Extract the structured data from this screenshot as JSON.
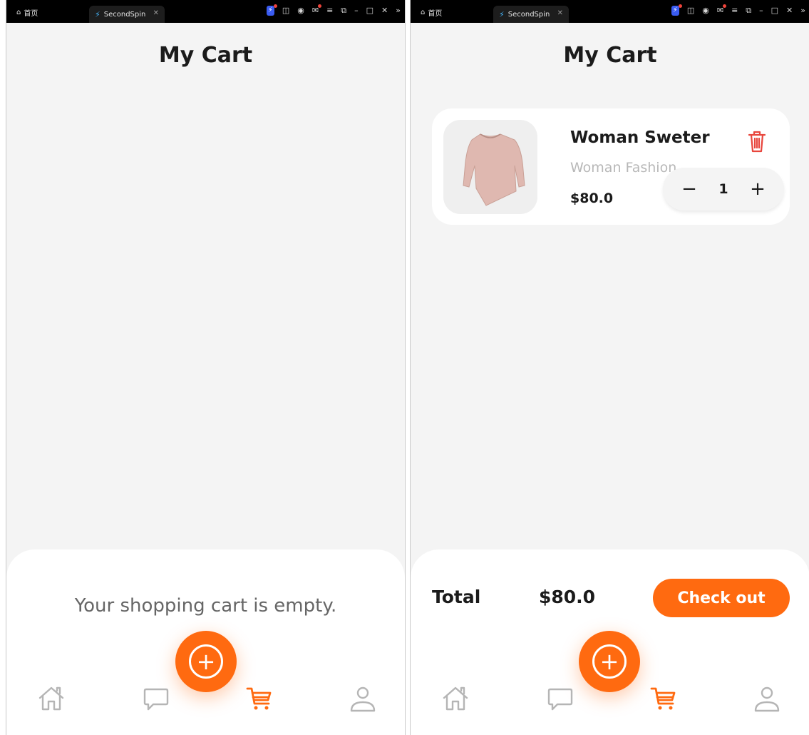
{
  "colors": {
    "accent": "#ff6a10",
    "nav_inactive": "#b5b5b5",
    "delete": "#e8453c"
  },
  "browser": {
    "home_label": "首页",
    "tab_title": "SecondSpin",
    "icons": [
      "bolt-icon",
      "gamepad-icon",
      "user-icon",
      "mail-icon",
      "menu-icon",
      "restore-icon",
      "minimize-icon",
      "maximize-icon",
      "close-icon",
      "more-icon"
    ]
  },
  "empty_screen": {
    "title": "My Cart",
    "empty_message": "Your shopping cart is empty."
  },
  "cart_screen": {
    "title": "My Cart",
    "items": [
      {
        "name": "Woman Sweter",
        "category": "Woman Fashion",
        "price": "$80.0",
        "quantity": "1"
      }
    ],
    "total_label": "Total",
    "total_value": "$80.0",
    "checkout_label": "Check out"
  },
  "bottom_nav": {
    "items": [
      "home",
      "chat",
      "cart",
      "profile"
    ],
    "active": "cart"
  }
}
